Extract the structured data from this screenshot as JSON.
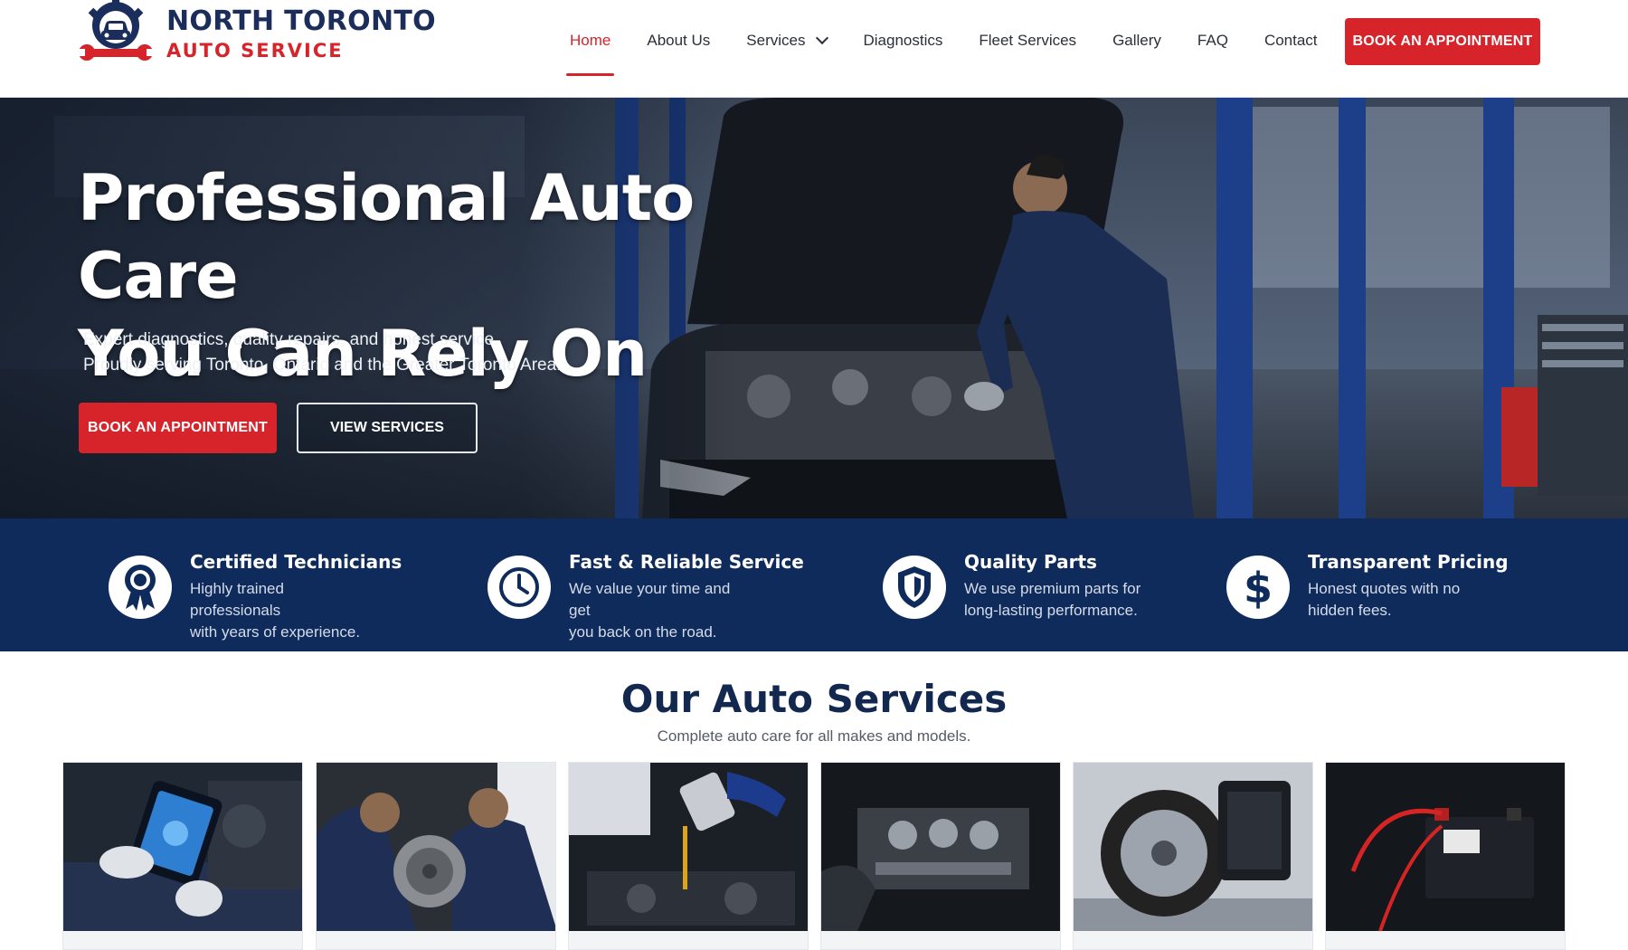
{
  "brand": {
    "line1": "NORTH TORONTO",
    "line2": "AUTO SERVICE",
    "primary_color": "#d7232a",
    "navy_color": "#0f2b5b"
  },
  "nav": {
    "items": [
      {
        "label": "Home",
        "active": true
      },
      {
        "label": "About Us"
      },
      {
        "label": "Services",
        "has_dropdown": true
      },
      {
        "label": "Diagnostics"
      },
      {
        "label": "Fleet Services"
      },
      {
        "label": "Gallery"
      },
      {
        "label": "FAQ"
      },
      {
        "label": "Contact"
      }
    ],
    "cta": "BOOK AN APPOINTMENT"
  },
  "hero": {
    "title_line1": "Professional Auto Care",
    "title_line2": "You Can Rely On",
    "sub_line1": "Expert diagnostics, quality repairs, and honest service.",
    "sub_line2": "Proudly serving Toronto, Ontario and the Greater Toronto Area.",
    "primary_cta": "BOOK AN APPOINTMENT",
    "secondary_cta": "VIEW SERVICES"
  },
  "features": [
    {
      "icon": "award-ribbon-icon",
      "title": "Certified Technicians",
      "desc_line1": "Highly trained professionals",
      "desc_line2": "with years of experience."
    },
    {
      "icon": "clock-icon",
      "title": "Fast & Reliable Service",
      "desc_line1": "We value your time and get",
      "desc_line2": "you back on the road."
    },
    {
      "icon": "shield-icon",
      "title": "Quality Parts",
      "desc_line1": "We use premium parts for",
      "desc_line2": "long-lasting performance."
    },
    {
      "icon": "dollar-icon",
      "title": "Transparent Pricing",
      "desc_line1": "Honest quotes with no",
      "desc_line2": "hidden fees."
    }
  ],
  "services": {
    "title": "Our Auto Services",
    "subtitle": "Complete auto care for all makes and models.",
    "cards": [
      {
        "image": "diagnostics-tablet-image"
      },
      {
        "image": "brake-repair-image"
      },
      {
        "image": "oil-change-image"
      },
      {
        "image": "engine-repair-image"
      },
      {
        "image": "wheel-alignment-image"
      },
      {
        "image": "battery-service-image"
      }
    ]
  }
}
